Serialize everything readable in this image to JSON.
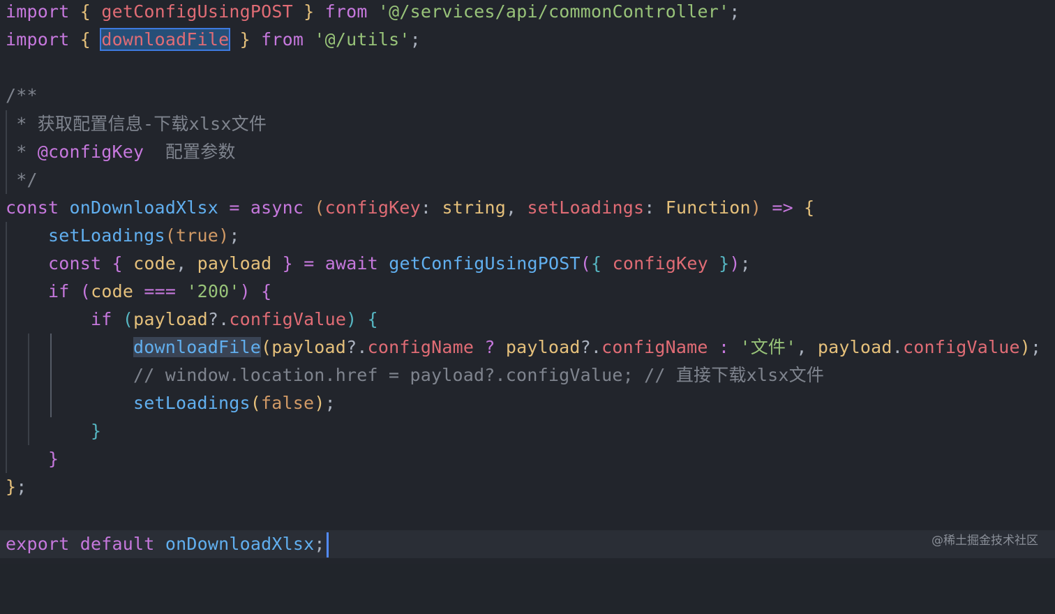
{
  "code": {
    "l1": {
      "import": "import",
      "brace_open": "{",
      "fn": "getConfigUsingPOST",
      "brace_close": "}",
      "from": "from",
      "path": "'@/services/api/commonController'",
      "semi": ";"
    },
    "l2": {
      "import": "import",
      "brace_open": "{",
      "fn": "downloadFile",
      "brace_close": "}",
      "from": "from",
      "path": "'@/utils'",
      "semi": ";"
    },
    "l4": {
      "text": "/**"
    },
    "l5": {
      "star": " *",
      "text": "获取配置信息-下载xlsx文件"
    },
    "l6": {
      "star": " *",
      "tag": "@configKey",
      "text": "配置参数"
    },
    "l7": {
      "text": " */"
    },
    "l8": {
      "const": "const",
      "name": "onDownloadXlsx",
      "eq": "=",
      "async": "async",
      "paren_open": "(",
      "p1": "configKey",
      "colon1": ":",
      "t1": "string",
      "comma": ",",
      "p2": "setLoadings",
      "colon2": ":",
      "t2": "Function",
      "paren_close": ")",
      "arrow": "=>",
      "brace": "{"
    },
    "l9": {
      "fn": "setLoadings",
      "open": "(",
      "arg": "true",
      "close": ")",
      "semi": ";"
    },
    "l10": {
      "const": "const",
      "brace_open": "{",
      "a": "code",
      "comma": ",",
      "b": "payload",
      "brace_close": "}",
      "eq": "=",
      "await": "await",
      "fn": "getConfigUsingPOST",
      "po": "(",
      "bo": "{",
      "arg": "configKey",
      "bc": "}",
      "pc": ")",
      "semi": ";"
    },
    "l11": {
      "if": "if",
      "po": "(",
      "var": "code",
      "op": "===",
      "str": "'200'",
      "pc": ")",
      "brace": "{"
    },
    "l12": {
      "if": "if",
      "po": "(",
      "obj": "payload",
      "dot": "?.",
      "prop": "configValue",
      "pc": ")",
      "brace": "{"
    },
    "l13": {
      "fn": "downloadFile",
      "po": "(",
      "o1": "payload",
      "d1": "?.",
      "p1": "configName",
      "q": "?",
      "o2": "payload",
      "d2": "?.",
      "p2": "configName",
      "colon": ":",
      "str": "'文件'",
      "comma": ",",
      "o3": "payload",
      "d3": ".",
      "p3": "configValue",
      "pc": ")",
      "semi": ";"
    },
    "l14": {
      "text": "// window.location.href = payload?.configValue; // 直接下载xlsx文件"
    },
    "l15": {
      "fn": "setLoadings",
      "open": "(",
      "arg": "false",
      "close": ")",
      "semi": ";"
    },
    "l16": {
      "brace": "}"
    },
    "l17": {
      "brace": "}"
    },
    "l18": {
      "brace": "}",
      "semi": ";"
    },
    "l20": {
      "export": "export",
      "default": "default",
      "name": "onDownloadXlsx",
      "semi": ";"
    }
  },
  "watermark": "@稀土掘金技术社区"
}
